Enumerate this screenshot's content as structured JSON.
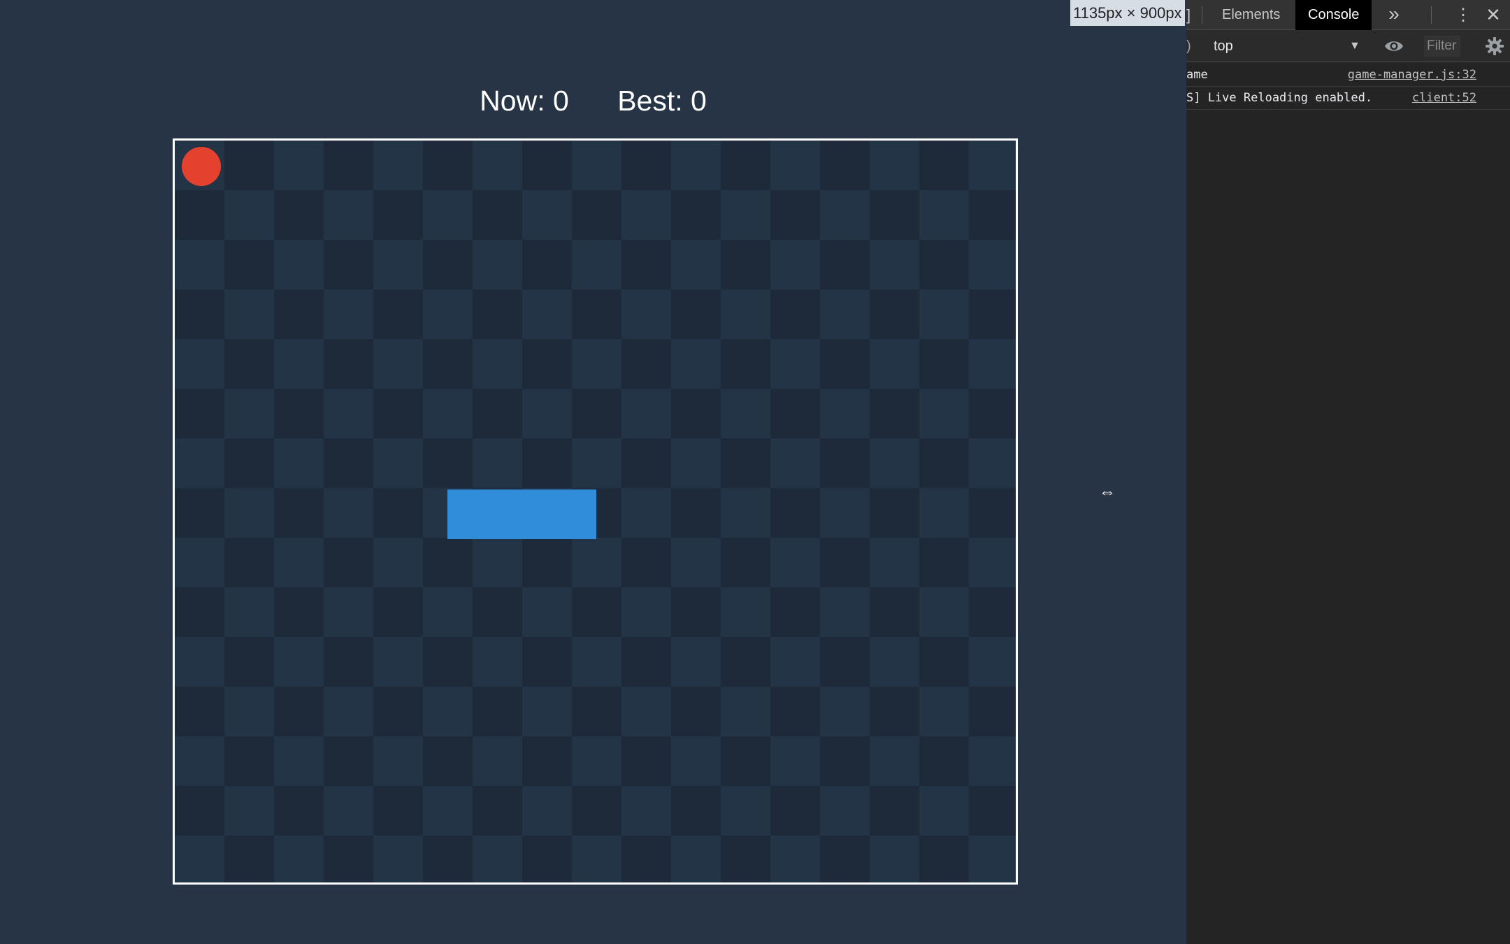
{
  "game": {
    "score_now": "Now: 0",
    "score_best": "Best: 0",
    "food_color": "#e5412f",
    "snake_color": "#2f8dd9",
    "board_cell_light": "#243447",
    "board_cell_dark": "#1e2a3a"
  },
  "viewport": {
    "size_badge": "1135px × 900px"
  },
  "devtools": {
    "left_glyph": "]",
    "tabs": [
      {
        "label": "Elements",
        "active": false
      },
      {
        "label": "Console",
        "active": true
      }
    ],
    "more_tabs_label": "»",
    "toolbar": {
      "left_glyph": ")",
      "context": "top",
      "filter_placeholder": "Filter"
    },
    "log": [
      {
        "message": "ame",
        "source": "game-manager.js:32"
      },
      {
        "message": "S] Live Reloading enabled.",
        "source": "client:52"
      }
    ]
  }
}
